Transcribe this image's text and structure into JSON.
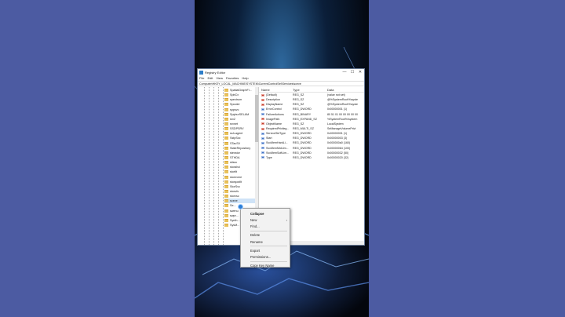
{
  "window": {
    "title": "Registry Editor",
    "controls": {
      "minimize": "—",
      "maximize": "☐",
      "close": "✕"
    },
    "menu": [
      "File",
      "Edit",
      "View",
      "Favorites",
      "Help"
    ],
    "address": "Computer\\HKEY_LOCAL_MACHINE\\SYSTEM\\CurrentControlSet\\Services\\sceve"
  },
  "tree": {
    "items": [
      "SpatialGraphFi...",
      "SpbCx",
      "spectrum",
      "Spooler",
      "sppsvc",
      "SpyburSELAM",
      "srv2",
      "srvnet",
      "SSDPSRV",
      "ssh-agent",
      "SstpSvc",
      "STacSV",
      "StateRepository",
      "stexstor",
      "STHDA",
      "stisvc",
      "storahci",
      "storfit",
      "stornvme",
      "storqosflt",
      "StorSvc",
      "storufs",
      "storvsc",
      "sceve",
      "Se...",
      "swenu",
      "swpr...",
      "Synth...",
      "SysM..."
    ],
    "selected_index": 23
  },
  "list": {
    "headers": [
      "Name",
      "Type",
      "Data"
    ],
    "rows": [
      {
        "icon": "ab",
        "name": "(Default)",
        "type": "REG_SZ",
        "data": "(value not set)"
      },
      {
        "icon": "ab",
        "name": "Description",
        "type": "REG_SZ",
        "data": "@%SystemRoot%\\syste"
      },
      {
        "icon": "ab",
        "name": "DisplayName",
        "type": "REG_SZ",
        "data": "@%SystemRoot%\\syste"
      },
      {
        "icon": "bin",
        "name": "ErrorControl",
        "type": "REG_DWORD",
        "data": "0x00000001 (1)"
      },
      {
        "icon": "bin",
        "name": "FailureActions",
        "type": "REG_BINARY",
        "data": "80 51 01 00 00 00 00 00"
      },
      {
        "icon": "ab",
        "name": "ImagePath",
        "type": "REG_EXPAND_SZ",
        "data": "%SystemRoot%\\system"
      },
      {
        "icon": "ab",
        "name": "ObjectName",
        "type": "REG_SZ",
        "data": "LocalSystem"
      },
      {
        "icon": "ab",
        "name": "RequiredPrivileg...",
        "type": "REG_MULTI_SZ",
        "data": "SeManageVolumePrivi"
      },
      {
        "icon": "bin",
        "name": "ServiceSidType",
        "type": "REG_DWORD",
        "data": "0x00000001 (1)"
      },
      {
        "icon": "bin",
        "name": "Start",
        "type": "REG_DWORD",
        "data": "0x00000003 (3)"
      },
      {
        "icon": "bin",
        "name": "SvcMemHardLi...",
        "type": "REG_DWORD",
        "data": "0x000000a0 (160)"
      },
      {
        "icon": "bin",
        "name": "SvcMemMidLim...",
        "type": "REG_DWORD",
        "data": "0x00000064 (100)"
      },
      {
        "icon": "bin",
        "name": "SvcMemSoftLim...",
        "type": "REG_DWORD",
        "data": "0x00000032 (50)"
      },
      {
        "icon": "bin",
        "name": "Type",
        "type": "REG_DWORD",
        "data": "0x00000020 (32)"
      }
    ]
  },
  "context_menu": {
    "items": [
      {
        "label": "Collapse",
        "bold": true
      },
      {
        "label": "New",
        "arrow": "›"
      },
      {
        "label": "Find..."
      },
      {
        "sep": true
      },
      {
        "label": "Delete"
      },
      {
        "label": "Rename"
      },
      {
        "sep": true
      },
      {
        "label": "Export"
      },
      {
        "label": "Permissions..."
      },
      {
        "sep": true
      },
      {
        "label": "Copy Key Name"
      }
    ]
  },
  "colors": {
    "page_bg": "#4b5aa0",
    "selection": "#cfe3f7",
    "accent": "#2d7fd6"
  }
}
